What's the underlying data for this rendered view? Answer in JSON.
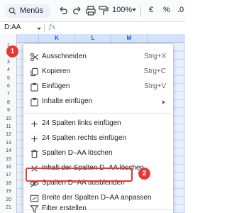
{
  "toolbar": {
    "search_label": "Menüs",
    "zoom": "100%",
    "currency": "€",
    "percent": "%",
    "decimal": ".0"
  },
  "formula_bar": {
    "name_box": "D:AA",
    "fx_label": "fx"
  },
  "sheet": {
    "columns": [
      "K",
      "L",
      "M"
    ],
    "rows": [
      "1",
      "2",
      "3",
      "4",
      "5",
      "6",
      "7",
      "8",
      "9",
      "10",
      "11",
      "12",
      "13",
      "14",
      "15",
      "16",
      "17",
      "18",
      "19",
      "20",
      "21"
    ]
  },
  "context_menu": {
    "items": [
      {
        "icon": "scissors-icon",
        "label": "Ausschneiden",
        "shortcut": "Strg+X"
      },
      {
        "icon": "copy-icon",
        "label": "Kopieren",
        "shortcut": "Strg+C"
      },
      {
        "icon": "paste-icon",
        "label": "Einfügen",
        "shortcut": "Strg+V"
      },
      {
        "icon": "paste-special-icon",
        "label": "Inhalte einfügen",
        "shortcut": ""
      },
      {
        "icon": "plus-icon",
        "label": "24 Spalten links einfügen",
        "shortcut": ""
      },
      {
        "icon": "plus-icon",
        "label": "24 Spalten rechts einfügen",
        "shortcut": ""
      },
      {
        "icon": "trash-icon",
        "label": "Spalten D–AA löschen",
        "shortcut": ""
      },
      {
        "icon": "close-icon",
        "label": "Inhalt der Spalten D–AA löschen",
        "shortcut": ""
      },
      {
        "icon": "eye-off-icon",
        "label": "Spalten D–AA ausblenden",
        "shortcut": ""
      },
      {
        "icon": "resize-icon",
        "label": "Breite der Spalten D–AA anpassen",
        "shortcut": ""
      },
      {
        "icon": "filter-icon",
        "label": "Filter erstellen",
        "shortcut": ""
      }
    ]
  },
  "callouts": {
    "step1": "1",
    "step2": "2"
  },
  "colors": {
    "highlight": "#e53935",
    "selected_column_header": "#d3e3fd",
    "selected_cells": "#e8f0fe"
  }
}
